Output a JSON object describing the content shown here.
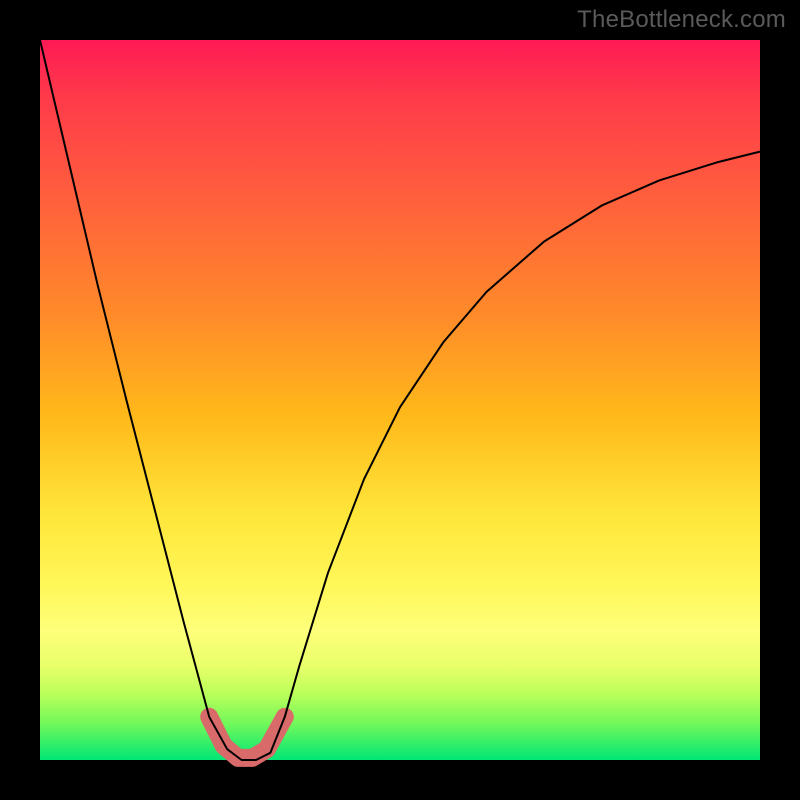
{
  "watermark": "TheBottleneck.com",
  "chart_data": {
    "type": "line",
    "title": "",
    "xlabel": "",
    "ylabel": "",
    "xlim": [
      0,
      1
    ],
    "ylim": [
      0,
      1
    ],
    "legend": false,
    "grid": false,
    "background": "red-yellow-green vertical gradient",
    "annotations": [
      {
        "text": "TheBottleneck.com",
        "position": "top-right",
        "color": "#5a5a5a"
      }
    ],
    "series": [
      {
        "name": "black-curve",
        "color": "#000000",
        "stroke_width": 2,
        "x": [
          0.0,
          0.04,
          0.08,
          0.12,
          0.16,
          0.2,
          0.235,
          0.26,
          0.28,
          0.3,
          0.32,
          0.34,
          0.36,
          0.4,
          0.45,
          0.5,
          0.56,
          0.62,
          0.7,
          0.78,
          0.86,
          0.94,
          1.0
        ],
        "values": [
          1.0,
          0.83,
          0.66,
          0.5,
          0.345,
          0.19,
          0.06,
          0.015,
          0.0,
          0.0,
          0.01,
          0.06,
          0.13,
          0.26,
          0.39,
          0.49,
          0.58,
          0.65,
          0.72,
          0.77,
          0.805,
          0.83,
          0.845
        ]
      },
      {
        "name": "valley-marker",
        "color": "#d96a6a",
        "stroke_width": 18,
        "linecap": "round",
        "x": [
          0.235,
          0.255,
          0.275,
          0.295,
          0.315,
          0.34
        ],
        "values": [
          0.06,
          0.02,
          0.003,
          0.003,
          0.015,
          0.06
        ]
      }
    ]
  }
}
